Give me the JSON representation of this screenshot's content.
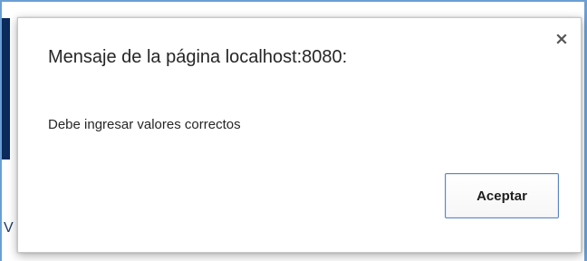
{
  "dialog": {
    "title": "Mensaje de la página localhost:8080:",
    "message": "Debe ingresar valores correctos",
    "accept_label": "Aceptar",
    "close_icon": "close-icon"
  },
  "background": {
    "partial_letter": "V"
  },
  "colors": {
    "frame_border": "#6a9fd4",
    "background_strip": "#0c2a5b",
    "button_border": "#5b84c4"
  }
}
